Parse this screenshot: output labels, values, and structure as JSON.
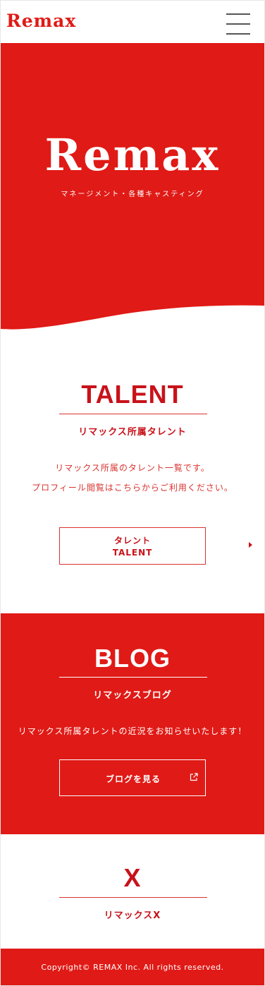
{
  "header": {
    "logo": "Remax",
    "menu_icon": "hamburger-menu-icon"
  },
  "hero": {
    "logo": "Remax",
    "subtitle": "マネージメント・各種キャスティング"
  },
  "talent": {
    "title": "TALENT",
    "subtitle": "リマックス所属タレント",
    "desc_line1": "リマックス所属のタレント一覧です。",
    "desc_line2": "プロフィール閲覧はこちらからご利用ください。",
    "button_line1": "タレント",
    "button_line2": "TALENT",
    "arrow_icon": "chevron-right-icon"
  },
  "blog": {
    "title": "BLOG",
    "subtitle": "リマックスブログ",
    "desc": "リマックス所属タレントの近況をお知らせいたします！",
    "button_label": "ブログを見る",
    "button_icon": "external-link-icon"
  },
  "x": {
    "title": "X",
    "subtitle": "リマックスX"
  },
  "footer": {
    "copyright": "Copyright© REMAX Inc. All rights reserved."
  },
  "colors": {
    "brand_red": "#e01a16",
    "text_red": "#c8121a",
    "white": "#ffffff"
  }
}
